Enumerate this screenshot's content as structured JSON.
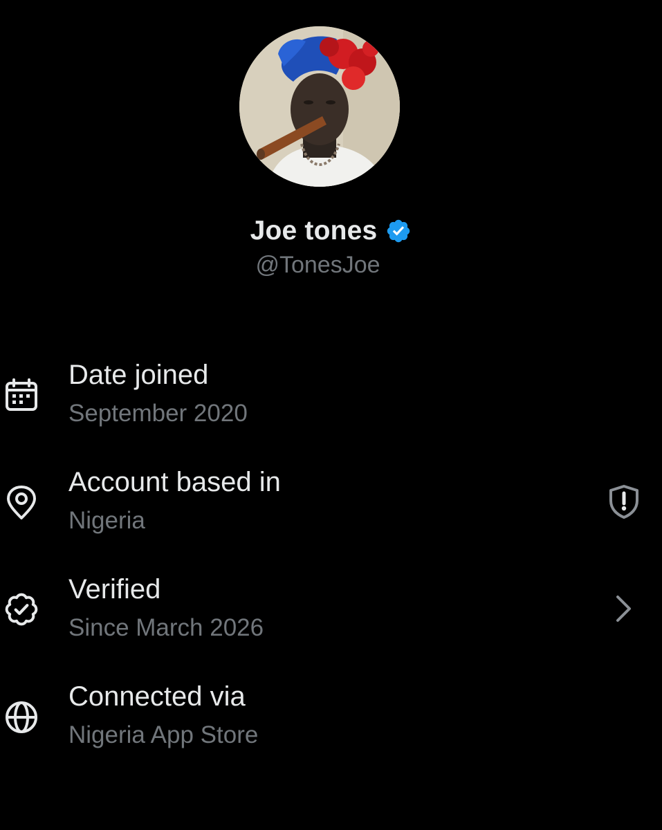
{
  "profile": {
    "display_name": "Joe tones",
    "handle": "@TonesJoe"
  },
  "rows": [
    {
      "title": "Date joined",
      "value": "September 2020",
      "icon": "calendar-icon"
    },
    {
      "title": "Account based in",
      "value": "Nigeria",
      "icon": "location-pin-icon",
      "trailing": "shield-alert-icon"
    },
    {
      "title": "Verified",
      "value": "Since March 2026",
      "icon": "verified-outline-icon",
      "trailing": "chevron-right-icon"
    },
    {
      "title": "Connected via",
      "value": "Nigeria App Store",
      "icon": "globe-icon"
    }
  ],
  "colors": {
    "background": "#000000",
    "primary_text": "#e7e9ea",
    "secondary_text": "#71767b",
    "verified_blue": "#1d9bf0"
  }
}
